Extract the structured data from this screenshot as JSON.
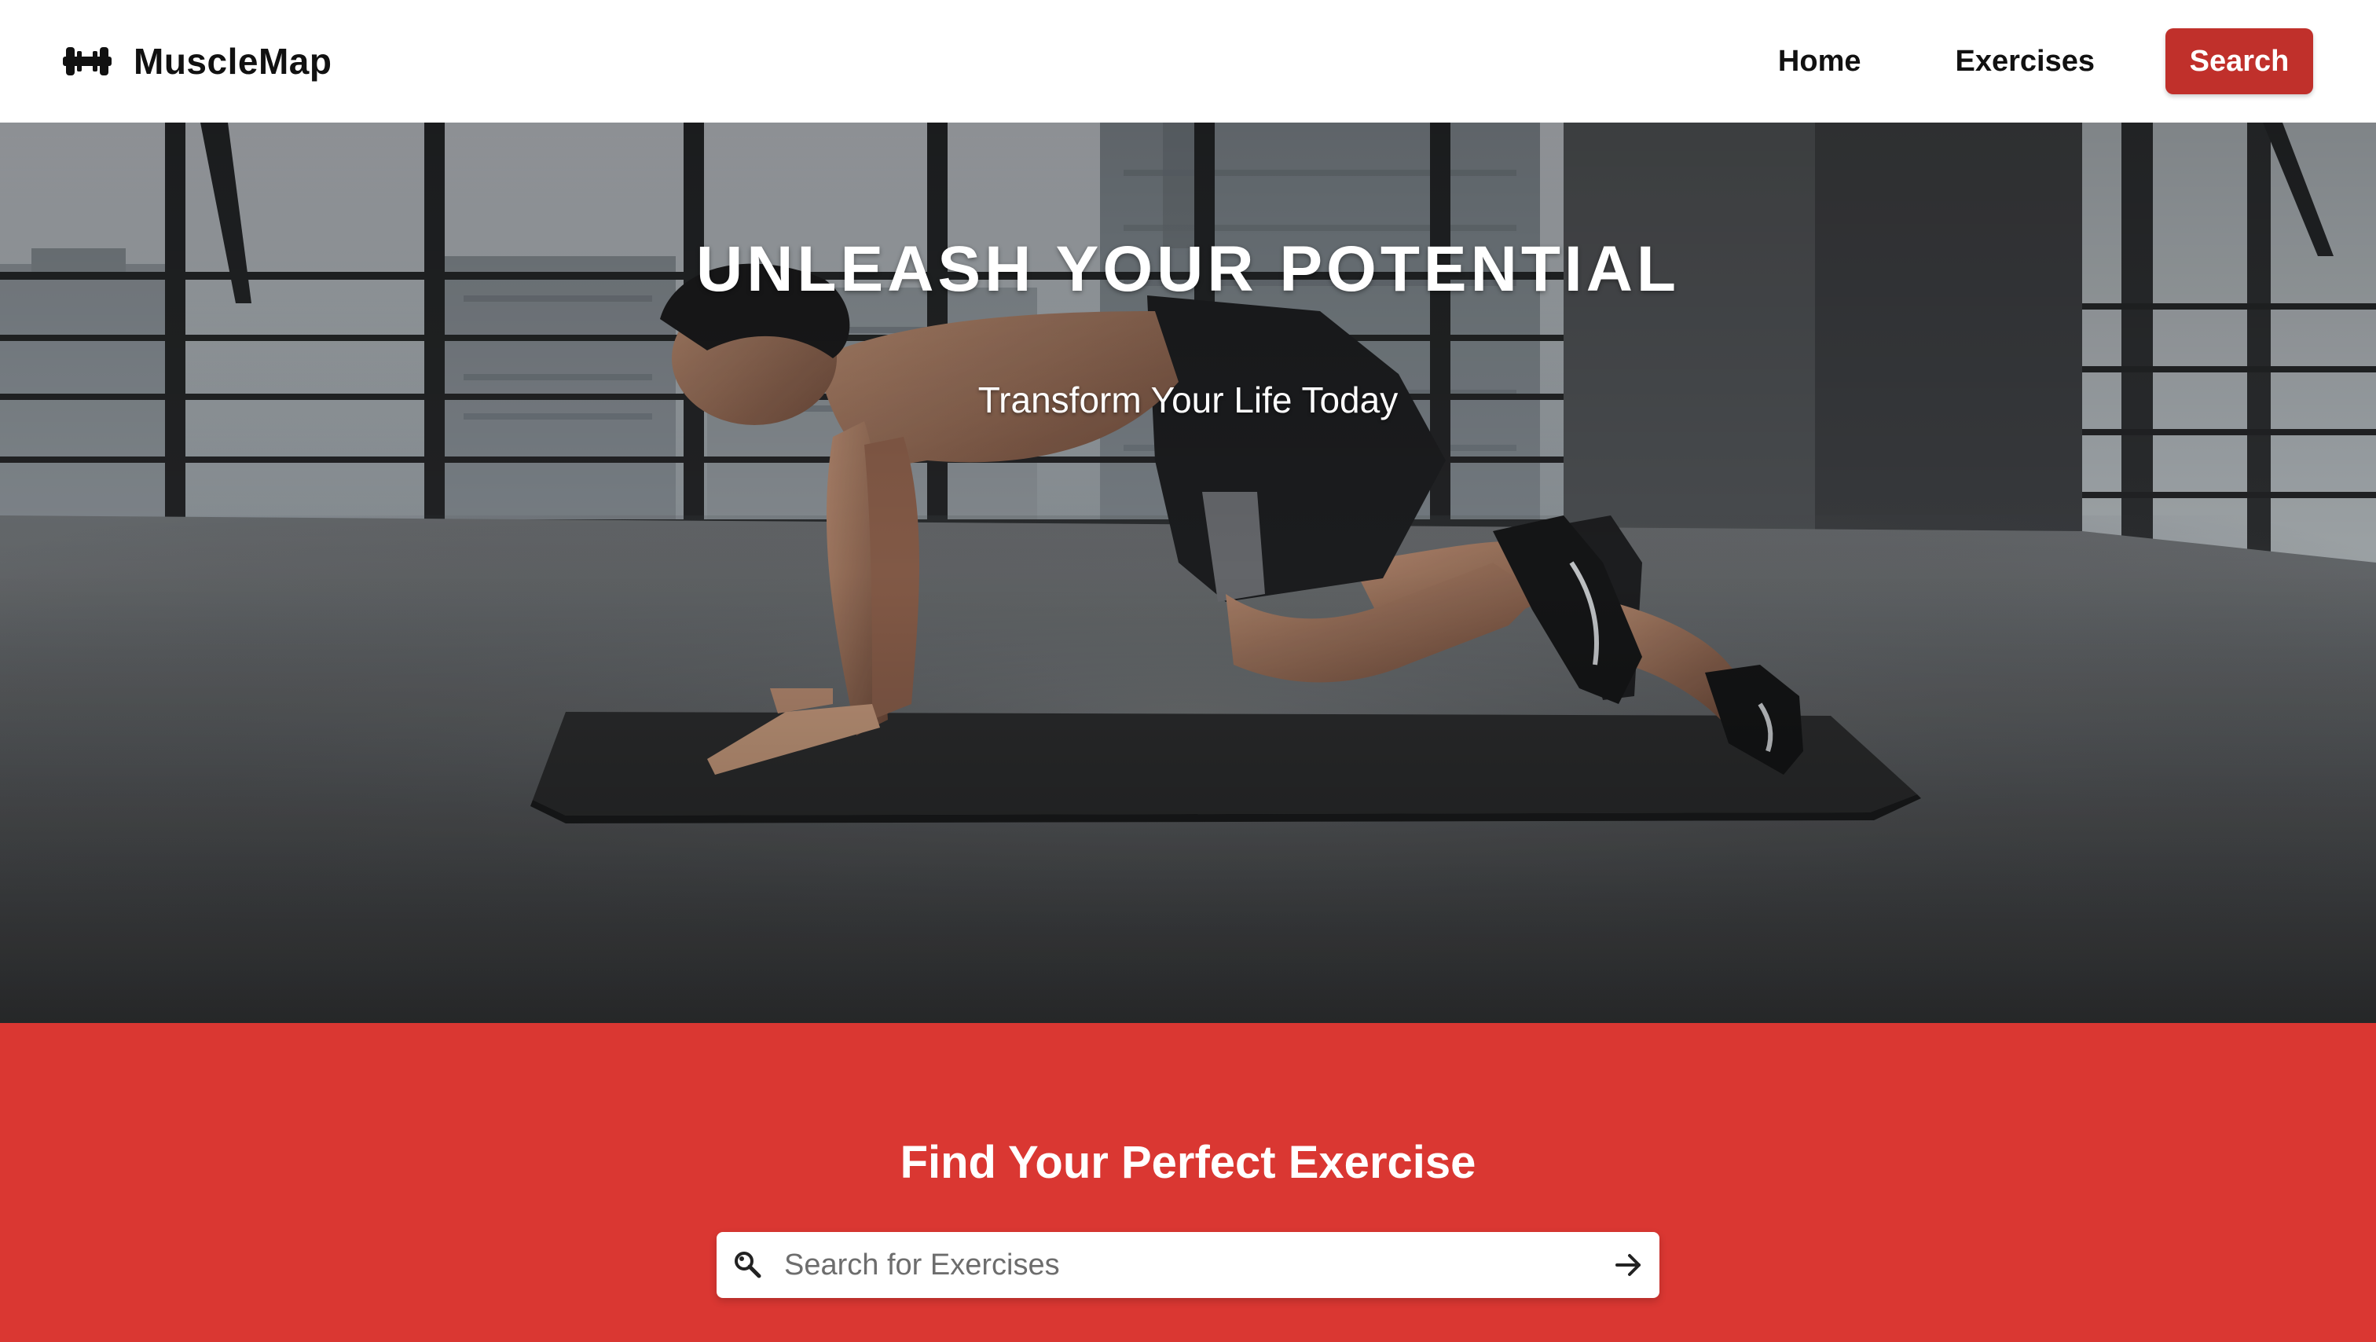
{
  "header": {
    "brand_name": "MuscleMap",
    "brand_icon": "dumbbell-icon",
    "nav": {
      "home_label": "Home",
      "exercises_label": "Exercises",
      "search_label": "Search"
    }
  },
  "hero": {
    "title": "UNLEASH YOUR POTENTIAL",
    "subtitle": "Transform Your Life Today",
    "image_icon": "fitness-hero-image"
  },
  "search_section": {
    "heading": "Find Your Perfect Exercise",
    "input_placeholder": "Search for Exercises",
    "input_value": "",
    "search_icon": "magnifier-icon",
    "submit_icon": "arrow-right-icon"
  },
  "colors": {
    "accent_red": "#c0302b",
    "section_red": "#da3732",
    "nav_text": "#111111",
    "white": "#ffffff"
  }
}
